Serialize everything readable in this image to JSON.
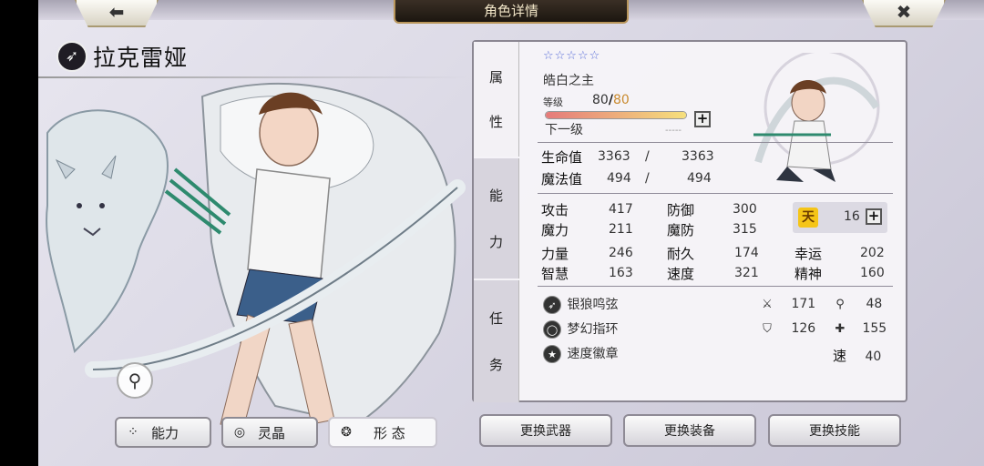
{
  "header": {
    "title": "角色详情",
    "back_icon": "back-arrow-icon",
    "close_icon": "close-icon"
  },
  "character": {
    "name": "拉克雷娅",
    "class_icon": "bow-class-icon"
  },
  "left_tabs": [
    {
      "label": "能力",
      "icon": "stats-icon"
    },
    {
      "label": "灵晶",
      "icon": "crystal-icon"
    },
    {
      "label": "形 态",
      "icon": "form-icon"
    }
  ],
  "panel": {
    "side_tabs": [
      {
        "chars": [
          "属",
          "性"
        ]
      },
      {
        "chars": [
          "能",
          "力"
        ]
      },
      {
        "chars": [
          "任",
          "务"
        ]
      }
    ],
    "stars": "☆☆☆☆☆",
    "title": "皓白之主",
    "level": {
      "label": "等级",
      "current": "80",
      "max": "80",
      "slash": "/",
      "exp_fraction": 1.0,
      "next_label": "下一级",
      "next_value": "-----"
    },
    "hp": {
      "label": "生命值",
      "current": "3363",
      "max": "3363",
      "sep": "/"
    },
    "mp": {
      "label": "魔法值",
      "current": "494",
      "max": "494",
      "sep": "/"
    },
    "stats": {
      "atk": {
        "label": "攻击",
        "value": "417"
      },
      "def": {
        "label": "防御",
        "value": "300"
      },
      "mag": {
        "label": "魔力",
        "value": "211"
      },
      "mdef": {
        "label": "魔防",
        "value": "315"
      },
      "str": {
        "label": "力量",
        "value": "246"
      },
      "end": {
        "label": "耐久",
        "value": "174"
      },
      "luck": {
        "label": "幸运",
        "value": "202"
      },
      "wis": {
        "label": "智慧",
        "value": "163"
      },
      "spd": {
        "label": "速度",
        "value": "321"
      },
      "spi": {
        "label": "精神",
        "value": "160"
      }
    },
    "talent": {
      "glyph": "天",
      "value": "16"
    },
    "equipment": [
      {
        "name": "银狼鸣弦",
        "icon": "bow-icon",
        "a_icon": "sword-icon",
        "a_val": "171",
        "b_icon": "staff-icon",
        "b_val": "48"
      },
      {
        "name": "梦幻指环",
        "icon": "ring-icon",
        "a_icon": "shield-icon",
        "a_val": "126",
        "b_icon": "cross-shield-icon",
        "b_val": "155"
      },
      {
        "name": "速度徽章",
        "icon": "badge-icon",
        "b_label": "速",
        "b_val": "40"
      }
    ]
  },
  "actions": [
    {
      "label": "更换武器"
    },
    {
      "label": "更换装备"
    },
    {
      "label": "更换技能"
    }
  ]
}
